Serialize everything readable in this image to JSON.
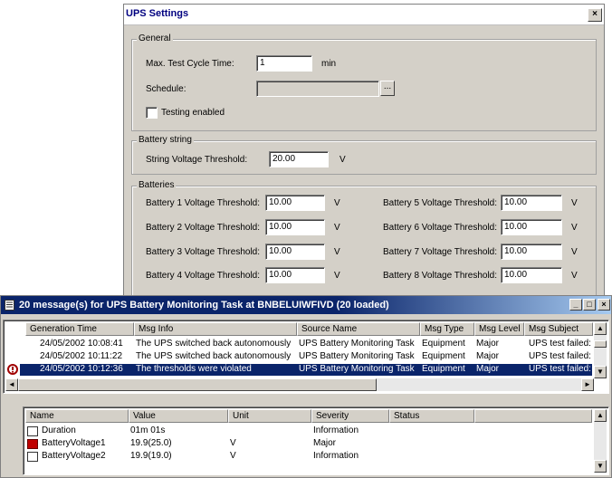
{
  "ups_dialog": {
    "title": "UPS Settings",
    "close_label": "×",
    "general": {
      "group_label": "General",
      "max_test_cycle_label": "Max. Test Cycle Time:",
      "max_test_cycle_value": "1",
      "max_test_cycle_unit": "min",
      "schedule_label": "Schedule:",
      "schedule_value": "",
      "schedule_button": "...",
      "testing_enabled_label": "Testing enabled",
      "testing_enabled_checked": false
    },
    "battery_string": {
      "group_label": "Battery string",
      "threshold_label": "String Voltage Threshold:",
      "threshold_value": "20.00",
      "unit": "V"
    },
    "batteries": {
      "group_label": "Batteries",
      "unit": "V",
      "left": [
        {
          "label": "Battery 1 Voltage Threshold:",
          "value": "10.00"
        },
        {
          "label": "Battery 2 Voltage Threshold:",
          "value": "10.00"
        },
        {
          "label": "Battery 3 Voltage Threshold:",
          "value": "10.00"
        },
        {
          "label": "Battery 4 Voltage Threshold:",
          "value": "10.00"
        }
      ],
      "right": [
        {
          "label": "Battery 5 Voltage Threshold:",
          "value": "10.00"
        },
        {
          "label": "Battery 6 Voltage Threshold:",
          "value": "10.00"
        },
        {
          "label": "Battery 7 Voltage Threshold:",
          "value": "10.00"
        },
        {
          "label": "Battery 8 Voltage Threshold:",
          "value": "10.00"
        }
      ]
    }
  },
  "messages_window": {
    "title": "20 message(s) for UPS Battery Monitoring Task at BNBELUIWFIVD (20 loaded)",
    "minimize_label": "_",
    "maximize_label": "□",
    "close_label": "×",
    "columns": [
      "Generation Time",
      "Msg Info",
      "Source Name",
      "Msg Type",
      "Msg Level",
      "Msg Subject"
    ],
    "rows": [
      {
        "time": "24/05/2002 10:08:41",
        "info": "The UPS switched back autonomously",
        "source": "UPS Battery Monitoring Task",
        "type": "Equipment",
        "level": "Major",
        "subject": "UPS test failed:",
        "selected": false
      },
      {
        "time": "24/05/2002 10:11:22",
        "info": "The UPS switched back autonomously",
        "source": "UPS Battery Monitoring Task",
        "type": "Equipment",
        "level": "Major",
        "subject": "UPS test failed:",
        "selected": false
      },
      {
        "time": "24/05/2002 10:12:36",
        "info": "The thresholds were violated",
        "source": "UPS Battery Monitoring Task",
        "type": "Equipment",
        "level": "Major",
        "subject": "UPS test failed:",
        "selected": true
      }
    ],
    "detail_columns": [
      "Name",
      "Value",
      "Unit",
      "Severity",
      "Status"
    ],
    "detail_rows": [
      {
        "name": "Duration",
        "value": "01m 01s",
        "unit": "",
        "severity": "Information",
        "status": ""
      },
      {
        "name": "BatteryVoltage1",
        "value": "19.9(25.0)",
        "unit": "V",
        "severity": "Major",
        "status": ""
      },
      {
        "name": "BatteryVoltage2",
        "value": "19.9(19.0)",
        "unit": "V",
        "severity": "Information",
        "status": ""
      }
    ]
  }
}
